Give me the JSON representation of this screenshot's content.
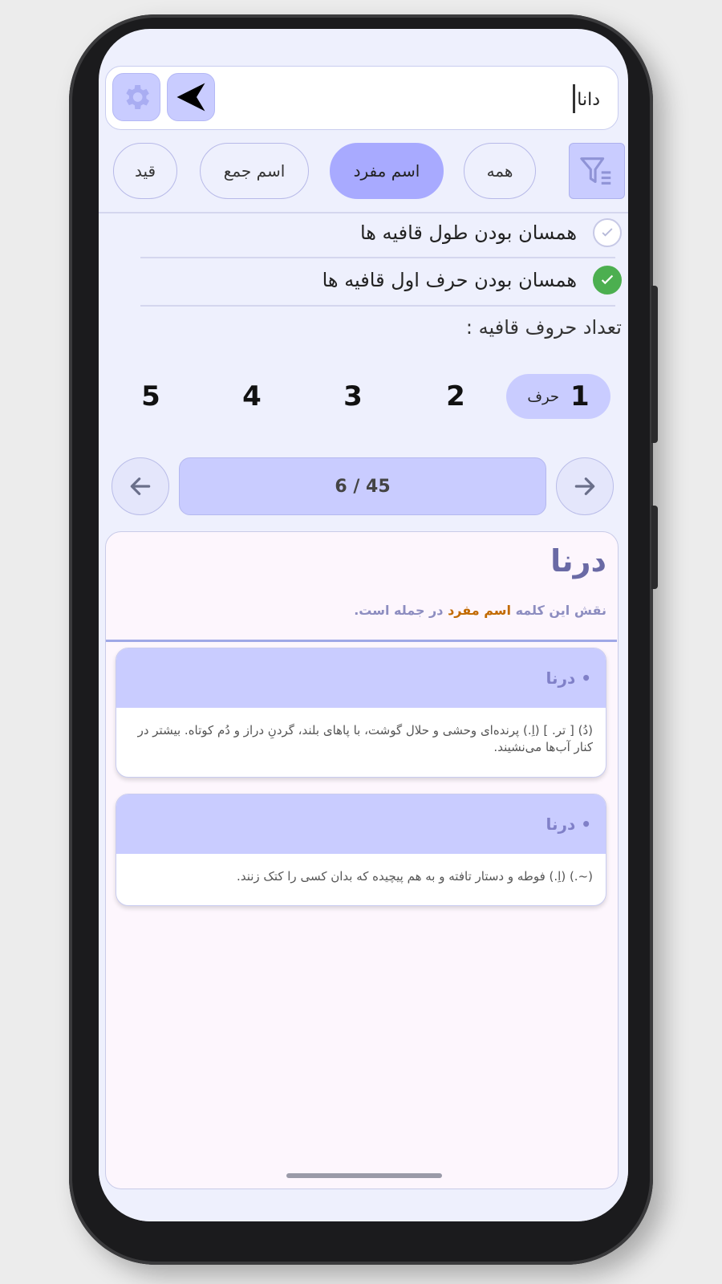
{
  "search": {
    "value": "دانا",
    "placeholder": ""
  },
  "icons": {
    "settings": "gear-icon",
    "back": "send-arrow-icon",
    "filter": "filter-icon",
    "prev": "arrow-left-icon",
    "next": "arrow-right-icon"
  },
  "chips": [
    {
      "label": "همه",
      "active": false
    },
    {
      "label": "اسم مفرد",
      "active": true
    },
    {
      "label": "اسم جمع",
      "active": false
    },
    {
      "label": "قید",
      "active": false
    }
  ],
  "checks": [
    {
      "label": "همسان بودن طول قافیه ها",
      "checked": false
    },
    {
      "label": "همسان بودن حرف اول قافیه ها",
      "checked": true
    }
  ],
  "letters_count": {
    "label": "تعداد حروف قافیه :",
    "options": [
      "1",
      "2",
      "3",
      "4",
      "5"
    ],
    "unit": "حرف",
    "selected": "1"
  },
  "pagination": {
    "indicator": "6 / 45"
  },
  "result": {
    "word": "درنا",
    "role_prefix": "نقش این کلمه",
    "role_value": "اسم مفرد",
    "role_suffix": "در جمله است.",
    "definitions": [
      {
        "title": "• درنا",
        "text": "(دُ) [ تر. ] (اِ.) پرنده‌ای وحشی و حلال گوشت، با پاهای بلند، گردنِ دراز و دُم کوتاه. بیشتر در کنار آب‌ها می‌نشیند."
      },
      {
        "title": "• درنا",
        "text": "(~.) (اِ.) فوطه و دستار تافته و به هم پیچیده که بدان کسی را کتک زنند."
      }
    ]
  },
  "colors": {
    "accent": "#a8aaff",
    "accent_light": "#c9ccff",
    "check_on": "#4caf50",
    "highlight": "#c26a00"
  }
}
